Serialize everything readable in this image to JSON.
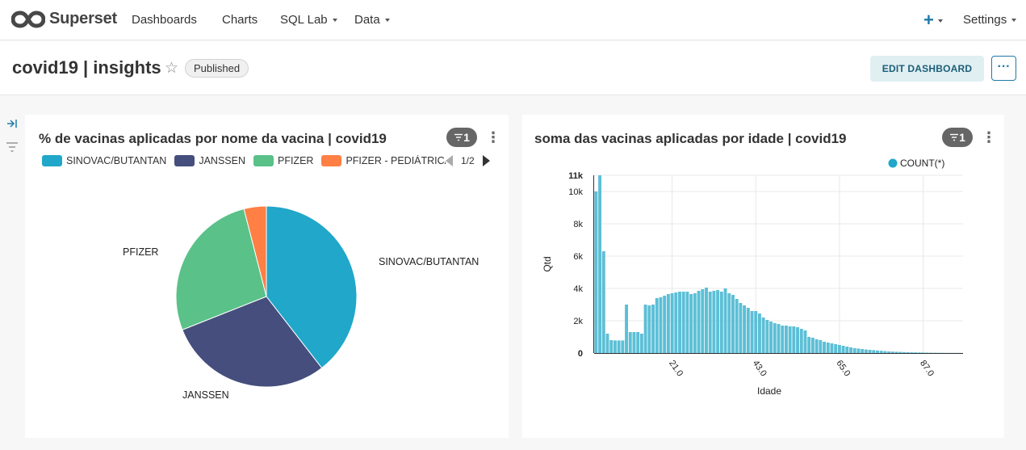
{
  "nav": {
    "brand": "Superset",
    "items": [
      "Dashboards",
      "Charts",
      "SQL Lab",
      "Data"
    ],
    "plus": "+",
    "settings": "Settings"
  },
  "header": {
    "title": "covid19 | insights",
    "status": "Published",
    "edit_label": "EDIT DASHBOARD",
    "more_label": "···"
  },
  "colors": {
    "accent": "#1f7aa8",
    "sinovac": "#20a7c9",
    "janssen": "#454e7c",
    "pfizer": "#5ac189",
    "pfizer_ped": "#ff7f44",
    "bar": "#5cbfd6"
  },
  "left_card": {
    "title": "% de vacinas aplicadas por nome da vacina | covid19",
    "filter_count": "1",
    "legend_page": "1/2",
    "legend": [
      "SINOVAC/BUTANTAN",
      "JANSSEN",
      "PFIZER",
      "PFIZER - PEDIÁTRICA"
    ],
    "pie_labels": {
      "sinovac": "SINOVAC/BUTANTAN",
      "janssen": "JANSSEN",
      "pfizer": "PFIZER"
    }
  },
  "right_card": {
    "title": "soma das vacinas aplicadas por idade | covid19",
    "filter_count": "1",
    "legend_label": "COUNT(*)",
    "xlabel": "Idade",
    "ylabel": "Qtd",
    "y_ticks": [
      "0",
      "2k",
      "4k",
      "6k",
      "8k",
      "10k",
      "11k"
    ],
    "x_ticks": [
      "21.0",
      "43.0",
      "65.0",
      "87.0"
    ]
  },
  "chart_data": [
    {
      "type": "pie",
      "title": "% de vacinas aplicadas por nome da vacina | covid19",
      "categories": [
        "SINOVAC/BUTANTAN",
        "JANSSEN",
        "PFIZER",
        "PFIZER - PEDIÁTRICA"
      ],
      "values": [
        39.5,
        29.5,
        27.0,
        4.0
      ]
    },
    {
      "type": "bar",
      "title": "soma das vacinas aplicadas por idade | covid19",
      "xlabel": "Idade",
      "ylabel": "Qtd",
      "series_name": "COUNT(*)",
      "x_start": 1,
      "x_step": 1,
      "ylim": [
        0,
        11000
      ],
      "x_ticks": [
        21,
        43,
        65,
        87
      ],
      "values": [
        10000,
        11000,
        6300,
        1200,
        800,
        780,
        780,
        780,
        3000,
        1300,
        1300,
        1300,
        1200,
        3000,
        2950,
        3000,
        3400,
        3450,
        3550,
        3650,
        3700,
        3750,
        3800,
        3800,
        3800,
        3650,
        3700,
        3850,
        3950,
        4050,
        3800,
        3850,
        3900,
        3800,
        4000,
        3700,
        3600,
        3350,
        3100,
        2950,
        2800,
        2600,
        2600,
        2450,
        2200,
        2050,
        1950,
        1850,
        1800,
        1700,
        1700,
        1650,
        1650,
        1600,
        1500,
        1400,
        1000,
        950,
        850,
        800,
        700,
        650,
        600,
        550,
        500,
        450,
        400,
        350,
        300,
        280,
        250,
        220,
        200,
        180,
        160,
        140,
        120,
        100,
        90,
        80,
        70,
        60,
        50,
        45,
        40,
        35,
        30,
        25,
        20,
        15,
        12,
        10,
        8,
        6,
        5,
        4,
        3
      ]
    }
  ]
}
